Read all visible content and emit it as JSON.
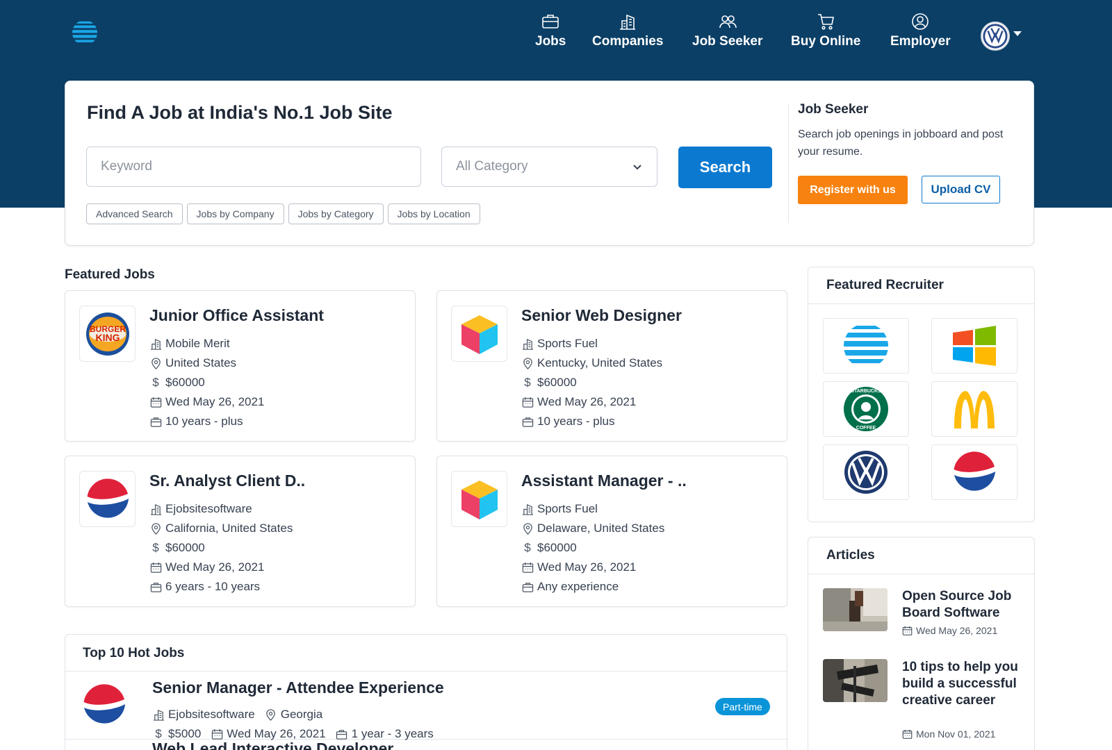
{
  "nav": {
    "items": [
      {
        "label": "Jobs",
        "icon": "briefcase-icon"
      },
      {
        "label": "Companies",
        "icon": "building-icon"
      },
      {
        "label": "Job Seeker",
        "icon": "users-icon"
      },
      {
        "label": "Buy Online",
        "icon": "cart-icon"
      },
      {
        "label": "Employer",
        "icon": "user-circle-icon"
      }
    ],
    "logo": "att-logo",
    "avatar": "volkswagen-avatar"
  },
  "search": {
    "title": "Find A Job at India's No.1 Job Site",
    "keyword_placeholder": "Keyword",
    "category_value": "All Category",
    "button_label": "Search",
    "chips": [
      "Advanced Search",
      "Jobs by Company",
      "Jobs by Category",
      "Jobs by Location"
    ]
  },
  "seeker": {
    "title": "Job Seeker",
    "description": "Search job openings in jobboard and post your resume.",
    "register_label": "Register with us",
    "upload_label": "Upload CV"
  },
  "featured": {
    "title": "Featured Jobs",
    "jobs": [
      {
        "title": "Junior Office Assistant",
        "company": "Mobile Merit",
        "location": "United States",
        "salary": "$60000",
        "date": "Wed May 26, 2021",
        "experience": "10 years - plus",
        "logo": "burger-king-logo"
      },
      {
        "title": "Senior Web Designer",
        "company": "Sports Fuel",
        "location": "Kentucky, United States",
        "salary": "$60000",
        "date": "Wed May 26, 2021",
        "experience": "10 years - plus",
        "logo": "cube-logo"
      },
      {
        "title": "Sr. Analyst Client D..",
        "company": "Ejobsitesoftware",
        "location": "California, United States",
        "salary": "$60000",
        "date": "Wed May 26, 2021",
        "experience": "6 years - 10 years",
        "logo": "pepsi-logo"
      },
      {
        "title": "Assistant Manager - ..",
        "company": "Sports Fuel",
        "location": "Delaware, United States",
        "salary": "$60000",
        "date": "Wed May 26, 2021",
        "experience": "Any experience",
        "logo": "cube-logo"
      }
    ]
  },
  "hot": {
    "title": "Top 10 Hot Jobs",
    "jobs": [
      {
        "title": "Senior Manager - Attendee Experience",
        "company": "Ejobsitesoftware",
        "location": "Georgia",
        "salary": "$5000",
        "date": "Wed May 26, 2021",
        "experience": "1 year - 3 years",
        "badge": "Part-time",
        "logo": "pepsi-logo"
      },
      {
        "title": "Web Lead Interactive Developer"
      }
    ]
  },
  "recruiters": {
    "title": "Featured Recruiter",
    "logos": [
      "att-logo",
      "windows-logo",
      "starbucks-logo",
      "mcdonalds-logo",
      "volkswagen-logo",
      "pepsi-logo"
    ]
  },
  "articles": {
    "title": "Articles",
    "items": [
      {
        "title": "Open Source Job Board Software",
        "date": "Wed May 26, 2021"
      },
      {
        "title": "10 tips to help you build a successful creative career",
        "date": "Mon Nov 01, 2021"
      }
    ]
  },
  "colors": {
    "header": "#0b3f66",
    "primary": "#0b79d0",
    "accent": "#f7820f",
    "badge": "#0b94d8"
  }
}
